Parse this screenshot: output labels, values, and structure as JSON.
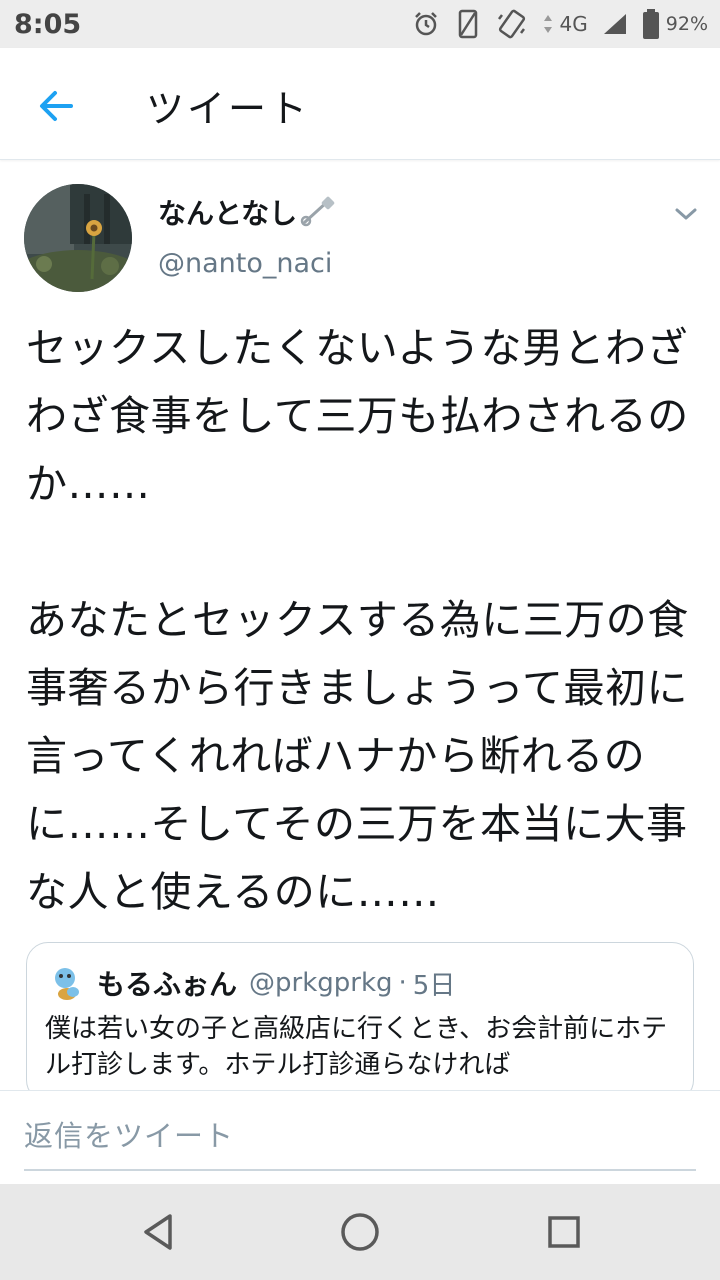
{
  "status_bar": {
    "time": "8:05",
    "network": "4G",
    "battery": "92%",
    "icons": [
      "alarm-icon",
      "vibrate-icon",
      "rotation-icon",
      "signal-icon",
      "battery-icon"
    ]
  },
  "header": {
    "title": "ツイート",
    "back_icon": "arrow-left-icon",
    "accent_color": "#1da1f2"
  },
  "tweet": {
    "author": {
      "name": "なんとなし",
      "name_icon": "safety-pin-icon",
      "handle": "@nanto_naci"
    },
    "text": "セックスしたくないような男とわざわざ食事をして三万も払わされるのか……\n\nあなたとセックスする為に三万の食事奢るから行きましょうって最初に言ってくれればハナから断れるのに……そしてその三万を本当に大事な人と使えるのに……",
    "quoted": {
      "name": "もるふぉん",
      "handle": "@prkgprkg",
      "separator": "·",
      "time": "5日",
      "text": "僕は若い女の子と高級店に行くとき、お会計前にホテル打診します。ホテル打診通らなければ"
    }
  },
  "reply": {
    "placeholder": "返信をツイート"
  },
  "nav": {
    "icons": [
      "back-triangle-icon",
      "home-circle-icon",
      "recents-square-icon"
    ]
  }
}
